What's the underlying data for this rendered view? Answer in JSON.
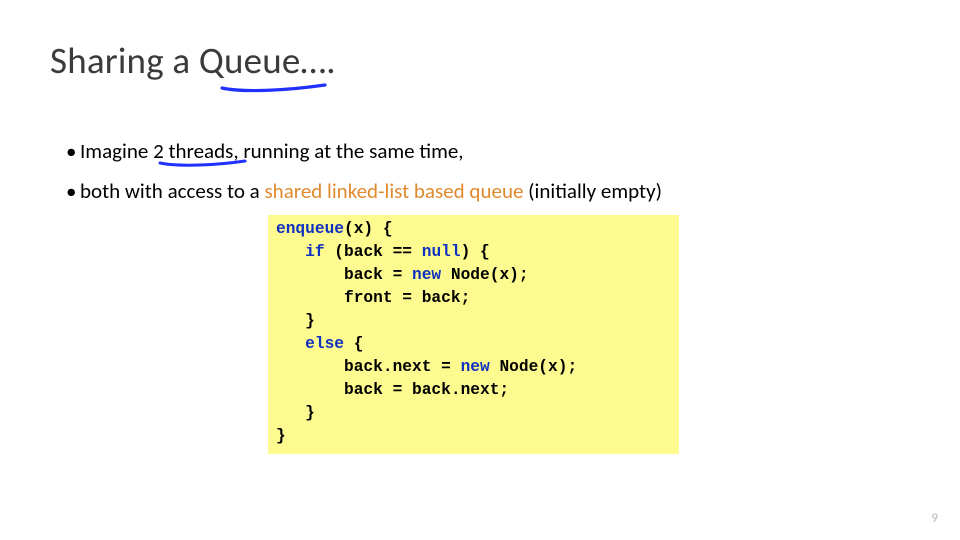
{
  "title_plain": "Sharing a Queue….",
  "bullets": {
    "line1_a": "Imagine ",
    "line1_b": "2 threads",
    "line1_c": ", running at the same time,",
    "line2_a": "both with access to a ",
    "line2_b": "shared linked-list based queue",
    "line2_c": " (initially empty)"
  },
  "code": {
    "l1a": "enqueue",
    "l1b": "(x) {",
    "l2a": "   ",
    "l2b": "if",
    "l2c": " (back == ",
    "l2d": "null",
    "l2e": ") {",
    "l3": "       back = ",
    "l3b": "new",
    "l3c": " Node(x);",
    "l4": "       front = back;",
    "l5": "   }",
    "l6a": "   ",
    "l6b": "else",
    "l6c": " {",
    "l7": "       back.next = ",
    "l7b": "new",
    "l7c": " Node(x);",
    "l8": "       back = back.next;",
    "l9": "   }",
    "l10": "}"
  },
  "page_number": "9"
}
